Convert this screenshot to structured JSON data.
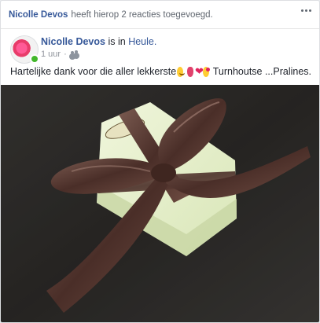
{
  "activity": {
    "actor": "Nicolle Devos",
    "text": "heeft hierop 2 reacties toegevoegd."
  },
  "post": {
    "author": "Nicolle Devos",
    "is_in": "is in",
    "place": "Heule.",
    "time": "1 uur",
    "separator": "·",
    "text_part1": "Hartelijke dank voor die aller lekkerste",
    "text_part2": "Turnhoutse ...Pralines."
  },
  "icons": {
    "more": "more-options-icon",
    "audience": "friends-icon"
  },
  "colors": {
    "link": "#365899",
    "online": "#42b72a",
    "ribbon": "#5a3a32",
    "box": "#e6f0c8"
  }
}
